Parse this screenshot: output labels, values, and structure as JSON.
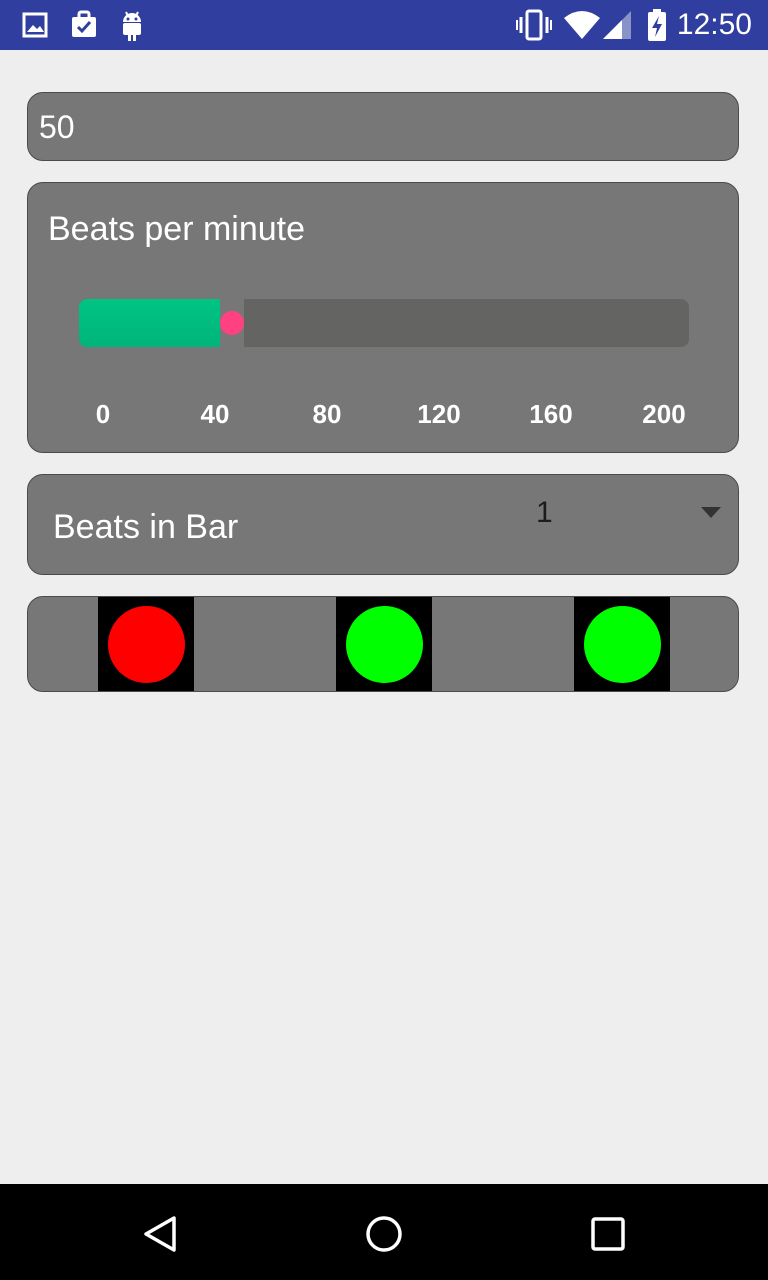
{
  "status_bar": {
    "time": "12:50",
    "icons": [
      "image-icon",
      "clipboard-check-icon",
      "android-icon",
      "vibrate-icon",
      "wifi-icon",
      "signal-icon",
      "battery-charging-icon"
    ]
  },
  "bpm_input": {
    "value": "50"
  },
  "bpm_slider": {
    "title": "Beats per minute",
    "min": 0,
    "max": 200,
    "value": 50,
    "ticks": [
      "0",
      "40",
      "80",
      "120",
      "160",
      "200"
    ],
    "fill_color": "#00b57a",
    "thumb_color": "#ff4081"
  },
  "beats_in_bar": {
    "label": "Beats in Bar",
    "selected": "1"
  },
  "beat_lights": [
    {
      "color": "#ff0000",
      "state": "active"
    },
    {
      "color": "#00ff00",
      "state": "inactive"
    },
    {
      "color": "#00ff00",
      "state": "inactive"
    }
  ],
  "nav_bar": {
    "buttons": [
      "back-icon",
      "home-icon",
      "recents-icon"
    ]
  }
}
